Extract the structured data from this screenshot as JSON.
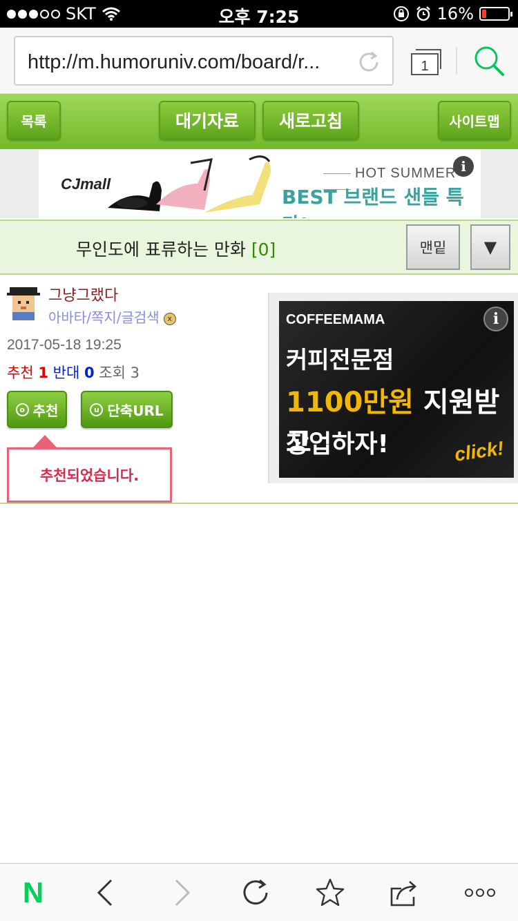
{
  "status_bar": {
    "carrier": "SKT",
    "time": "오후 7:25",
    "battery": "16%",
    "battery_level": 0.16
  },
  "browser": {
    "url": "http://m.humoruniv.com/board/r...",
    "tab_count": "1"
  },
  "toolbar": {
    "list_label": "목록",
    "pending_label": "대기자료",
    "refresh_label": "새로고침",
    "sitemap_label": "사이트맵"
  },
  "ad_top": {
    "logo": "CJmall",
    "tagline": "HOT SUMMER",
    "headline": "BEST 브랜드 샌들 특가!",
    "info": "i"
  },
  "post": {
    "title": "무인도에 표류하는 만화",
    "comment_count": "[0]",
    "bottom_label": "맨밑",
    "dropdown_symbol": "▼",
    "author": "그냥그랬다",
    "author_links": "아바타/쪽지/글검색",
    "date": "2017-05-18 19:25",
    "recommend_label": "추천",
    "recommend_count": "1",
    "oppose_label": "반대",
    "oppose_count": "0",
    "views_label": "조회",
    "views_count": "3",
    "recommend_button": "추천",
    "short_url_button": "단축URL",
    "recommended_message": "추천되었습니다."
  },
  "side_ad": {
    "brand": "COFFEEMAMA",
    "line1": "커피전문점",
    "line2_highlight": "1100만원",
    "line2_rest": "지원받고",
    "line3": "창업하자!",
    "click": "click!",
    "info": "i"
  },
  "bottom_bar": {
    "home_label": "N"
  },
  "colors": {
    "green_bar": "#7cc233",
    "title_bg": "#eaf5dd",
    "author": "#8b1a1a",
    "tooltip_border": "#e8637a",
    "naver_green": "#03cf5d"
  }
}
